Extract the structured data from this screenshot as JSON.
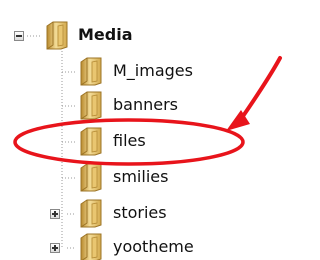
{
  "tree": {
    "root": {
      "label": "Media",
      "expanded": true,
      "icon": "folder-icon"
    },
    "children": [
      {
        "label": "M_images",
        "icon": "folder-icon",
        "has_children": false
      },
      {
        "label": "banners",
        "icon": "folder-icon",
        "has_children": false
      },
      {
        "label": "files",
        "icon": "folder-icon",
        "has_children": false,
        "highlighted": true
      },
      {
        "label": "smilies",
        "icon": "folder-icon",
        "has_children": false
      },
      {
        "label": "stories",
        "icon": "folder-icon",
        "has_children": true,
        "expanded": false
      },
      {
        "label": "yootheme",
        "icon": "folder-icon",
        "has_children": true,
        "expanded": false
      }
    ]
  },
  "annotation": {
    "color": "#e8141b",
    "shapes": [
      "ellipse-icon",
      "arrow-icon"
    ]
  },
  "colors": {
    "folder_light": "#f0d48a",
    "folder_dark": "#c9a040",
    "tree_line": "#9a9a9a"
  }
}
